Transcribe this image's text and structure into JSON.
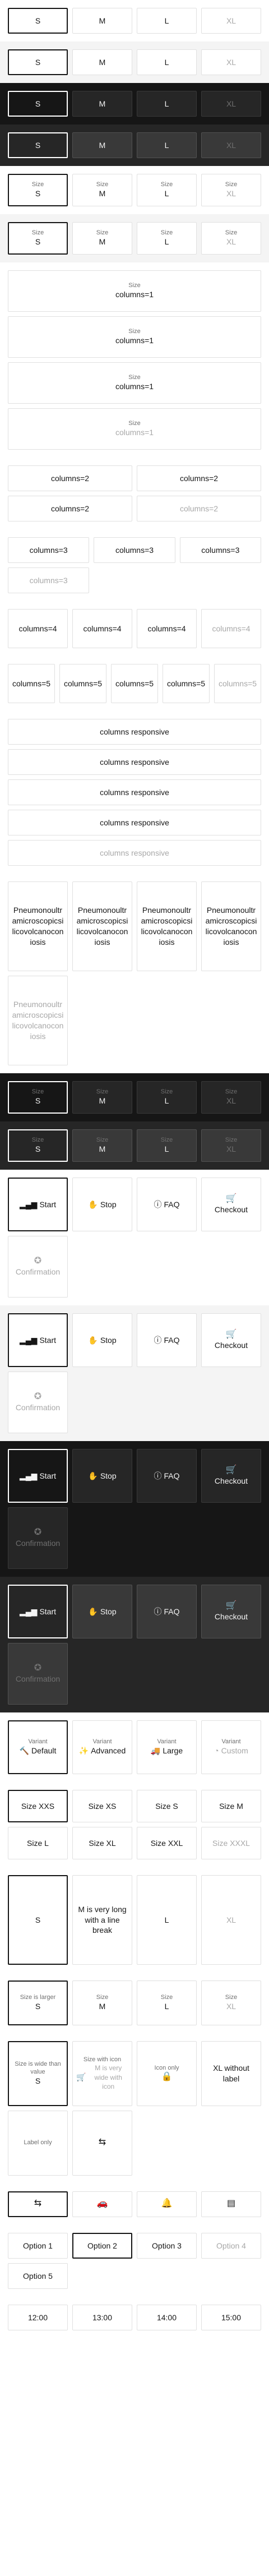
{
  "basic": [
    "S",
    "M",
    "L",
    "XL"
  ],
  "labeled": {
    "label": "Size",
    "values": [
      "S",
      "M",
      "L",
      "XL"
    ]
  },
  "columns1": {
    "label": "Size",
    "value": "columns=1"
  },
  "columns2": "columns=2",
  "columns3": "columns=3",
  "columns4": "columns=4",
  "columns5": "columns=5",
  "responsive": "columns responsive",
  "long_word": "Pneumonoultramicroscopicsilicovolcanoconiosis",
  "icons_row": [
    {
      "label": "Start",
      "icon": "bar-chart-icon"
    },
    {
      "label": "Stop",
      "icon": "hand-icon"
    },
    {
      "label": "FAQ",
      "icon": "help-icon"
    },
    {
      "label": "Checkout",
      "icon": "cart-icon"
    },
    {
      "label": "Confirmation",
      "icon": "badge-icon"
    }
  ],
  "variant": {
    "label": "Variant",
    "items": [
      {
        "label": "Default",
        "icon": "hammer-icon"
      },
      {
        "label": "Advanced",
        "icon": "magic-icon"
      },
      {
        "label": "Large",
        "icon": "truck-icon"
      },
      {
        "label": "Custom",
        "icon": "gauge-icon"
      }
    ]
  },
  "sizes": [
    "Size XXS",
    "Size XS",
    "Size S",
    "Size M",
    "Size L",
    "Size XL",
    "Size XXL",
    "Size XXXL"
  ],
  "line_break": [
    "S",
    "M is very long with a line break",
    "L",
    "XL"
  ],
  "larger": {
    "first_label": "Size is larger",
    "label": "Size",
    "values": [
      "S",
      "M",
      "L",
      "XL"
    ]
  },
  "mixed": {
    "wide_label": "Size is wide than value",
    "wide_value": "S",
    "icon_label": "Size with icon",
    "icon_value": "M is very wide with icon",
    "icon_only_label": "Icon only",
    "no_label_value": "XL without label",
    "label_only": "Label only"
  },
  "icon_only_row": [
    "truck-icon",
    "car-icon",
    "bell-icon",
    "card-icon"
  ],
  "options": [
    "Option 1",
    "Option 2",
    "Option 3",
    "Option 4",
    "Option 5"
  ],
  "times": [
    "12:00",
    "13:00",
    "14:00",
    "15:00"
  ]
}
